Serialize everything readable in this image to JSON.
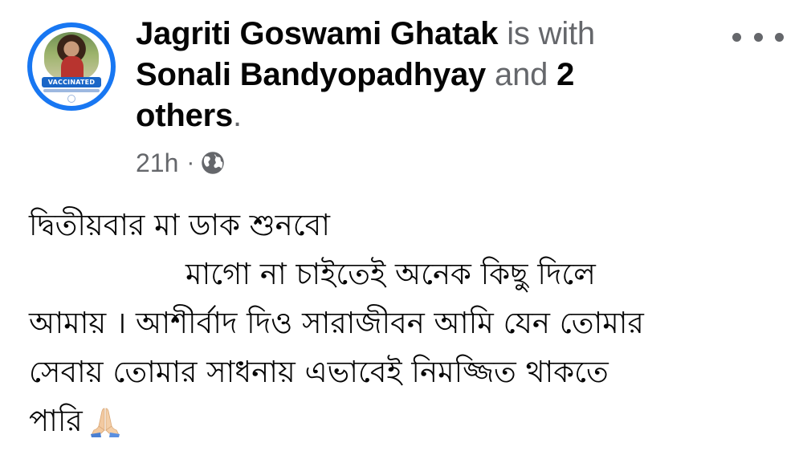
{
  "post": {
    "author": "Jagriti Goswami Ghatak",
    "with_text": "is with",
    "tagged_person": "Sonali Bandyopadhyay",
    "and_text": "and",
    "others_link": "2 others",
    "period": ".",
    "avatar_badge": "VACCINATED",
    "timestamp": "21h",
    "separator": "·",
    "privacy_icon": "globe-icon",
    "more_icon": "more-options-icon",
    "content_lines": [
      "দ্বিতীয়বার মা ডাক শুনবো",
      "মাগো না চাইতেই অনেক কিছু দিলে",
      "আমায় । আশীর্বাদ দিও সারাজীবন আমি যেন তোমার",
      "সেবায় তোমার সাধনায় এভাবেই নিমজ্জিত থাকতে",
      "পারি"
    ],
    "trailing_emoji": "folded-hands-emoji"
  },
  "colors": {
    "avatar_ring": "#1877f2",
    "primary_text": "#050505",
    "secondary_text": "#65676b"
  }
}
